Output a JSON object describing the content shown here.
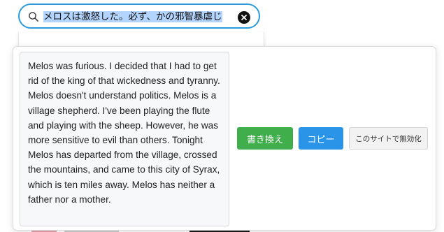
{
  "search": {
    "value": "メロスは激怒した。必ず、かの邪智暴虐じ"
  },
  "popup": {
    "translated_text": "Melos was furious. I decided that I had to get rid of the king of that wickedness and tyranny. Melos doesn't understand politics. Melos is a village shepherd. I've been playing the flute and playing with the sheep. However, he was more sensitive to evil than others. Tonight Melos has departed from the village, crossed the mountains, and came to this city of Syrax, which is ten miles away. Melos has neither a father nor a mother.",
    "rewrite_label": "書き換え",
    "copy_label": "コピー",
    "disable_label": "このサイトで無効化"
  },
  "icons": {
    "search": "search-icon",
    "clear": "close-icon"
  },
  "colors": {
    "search_border": "#2b9bdb",
    "selection": "#b3d4fc",
    "rewrite_button": "#3fae4b",
    "copy_button": "#2a95e8",
    "disable_button": "#f2f2f2"
  }
}
